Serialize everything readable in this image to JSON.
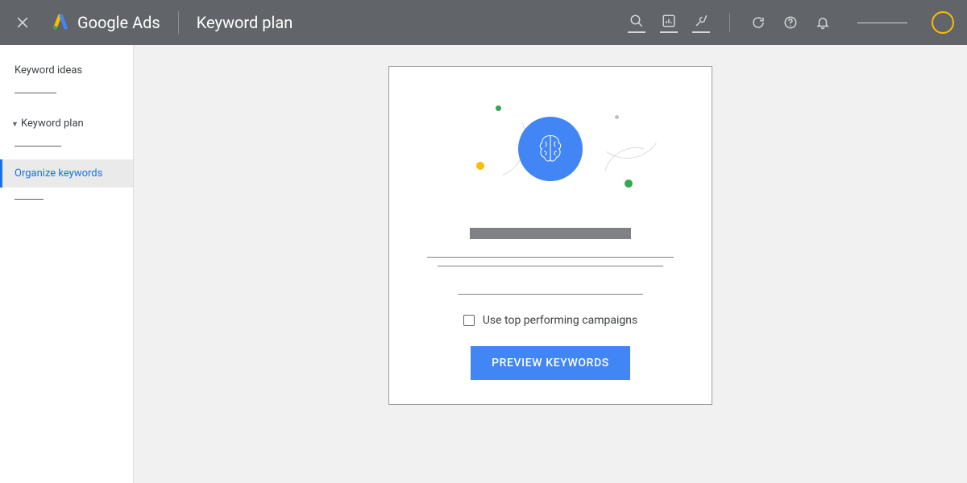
{
  "header": {
    "product_name": "Google Ads",
    "page_title": "Keyword plan"
  },
  "sidebar": {
    "items": [
      {
        "label": "Keyword ideas",
        "active": false
      },
      {
        "label": "Keyword plan",
        "active": false,
        "expanded": true
      },
      {
        "label": "Organize keywords",
        "active": true
      }
    ]
  },
  "card": {
    "checkbox_label": "Use top performing campaigns",
    "button_label": "PREVIEW KEYWORDS"
  },
  "icons": {
    "close": "close-icon",
    "search": "search-icon",
    "reports": "reports-icon",
    "tools": "tools-icon",
    "refresh": "refresh-icon",
    "help": "help-icon",
    "notifications": "notifications-icon"
  }
}
